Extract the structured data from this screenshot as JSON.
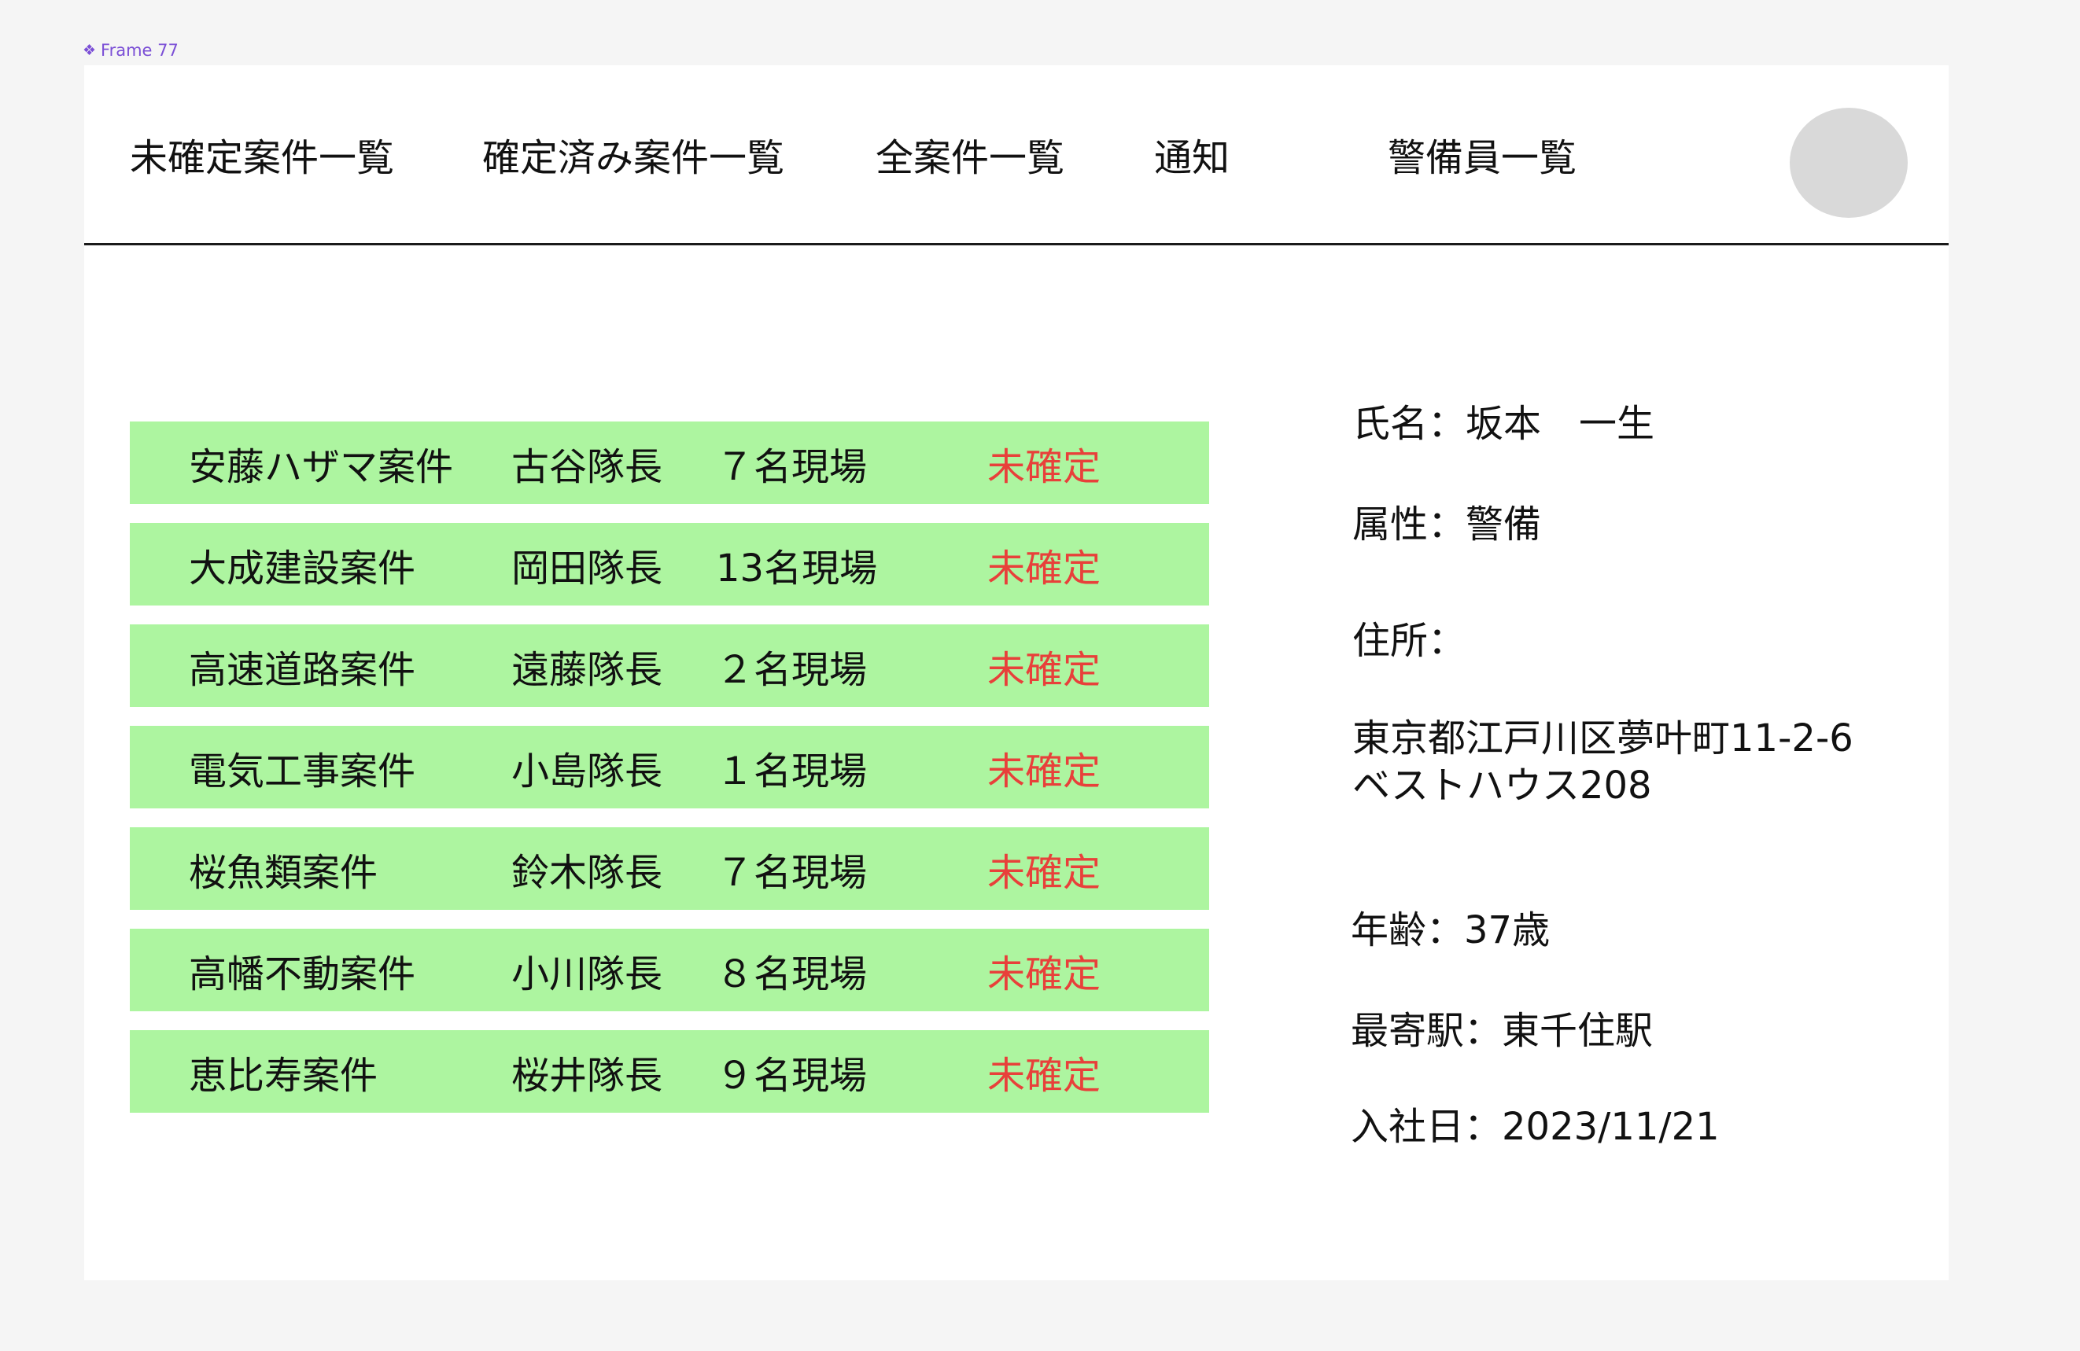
{
  "frame": {
    "label": "Frame 77",
    "icon": "component-diamond-icon"
  },
  "nav": {
    "items": [
      {
        "label": "未確定案件一覧"
      },
      {
        "label": "確定済み案件一覧"
      },
      {
        "label": "全案件一覧"
      },
      {
        "label": "通知"
      },
      {
        "label": "警備員一覧"
      }
    ]
  },
  "cases": [
    {
      "name": "安藤ハザマ案件",
      "leader": "古谷隊長",
      "count": "７名現場",
      "status": "未確定"
    },
    {
      "name": "大成建設案件",
      "leader": "岡田隊長",
      "count": "13名現場",
      "status": "未確定"
    },
    {
      "name": "高速道路案件",
      "leader": "遠藤隊長",
      "count": "２名現場",
      "status": "未確定"
    },
    {
      "name": "電気工事案件",
      "leader": "小島隊長",
      "count": "１名現場",
      "status": "未確定"
    },
    {
      "name": "桜魚類案件",
      "leader": "鈴木隊長",
      "count": "７名現場",
      "status": "未確定"
    },
    {
      "name": "高幡不動案件",
      "leader": "小川隊長",
      "count": "８名現場",
      "status": "未確定"
    },
    {
      "name": "恵比寿案件",
      "leader": "桜井隊長",
      "count": "９名現場",
      "status": "未確定"
    }
  ],
  "profile": {
    "name": "氏名：坂本　一生",
    "attribute": "属性：警備",
    "address_label": "住所：",
    "address_line1": "東京都江戸川区夢叶町11-2-6",
    "address_line2": "ベストハウス208",
    "age": "年齢：37歳",
    "station": "最寄駅：東千住駅",
    "join_date": "入社日：2023/11/21"
  },
  "colors": {
    "row_background": "#adf5a0",
    "status_text": "#e8403a",
    "frame_label": "#7b4fd6",
    "avatar": "#d9d9d9"
  }
}
